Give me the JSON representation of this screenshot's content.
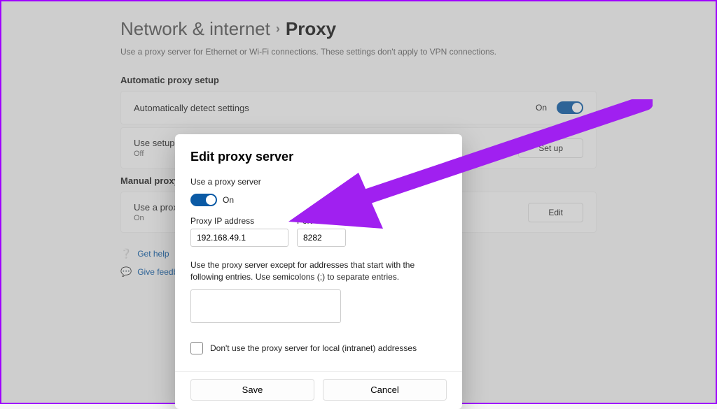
{
  "breadcrumb": {
    "parent": "Network & internet",
    "current": "Proxy"
  },
  "subtitle": "Use a proxy server for Ethernet or Wi-Fi connections. These settings don't apply to VPN connections.",
  "sections": {
    "auto_head": "Automatic proxy setup",
    "manual_head": "Manual proxy setup"
  },
  "cards": {
    "auto_detect": {
      "label": "Automatically detect settings",
      "state": "On"
    },
    "use_script": {
      "label": "Use setup script",
      "sub": "Off",
      "button": "Set up"
    },
    "use_proxy": {
      "label": "Use a proxy server",
      "sub": "On",
      "button": "Edit"
    }
  },
  "links": {
    "help": "Get help",
    "feedback": "Give feedback"
  },
  "modal": {
    "title": "Edit proxy server",
    "use_proxy_label": "Use a proxy server",
    "toggle_state": "On",
    "ip_label": "Proxy IP address",
    "ip_value": "192.168.49.1",
    "port_label": "Port",
    "port_value": "8282",
    "exceptions_hint": "Use the proxy server except for addresses that start with the following entries. Use semicolons (;) to separate entries.",
    "exceptions_value": "",
    "local_checkbox_label": "Don't use the proxy server for local (intranet) addresses",
    "local_checked": false,
    "save_label": "Save",
    "cancel_label": "Cancel"
  }
}
